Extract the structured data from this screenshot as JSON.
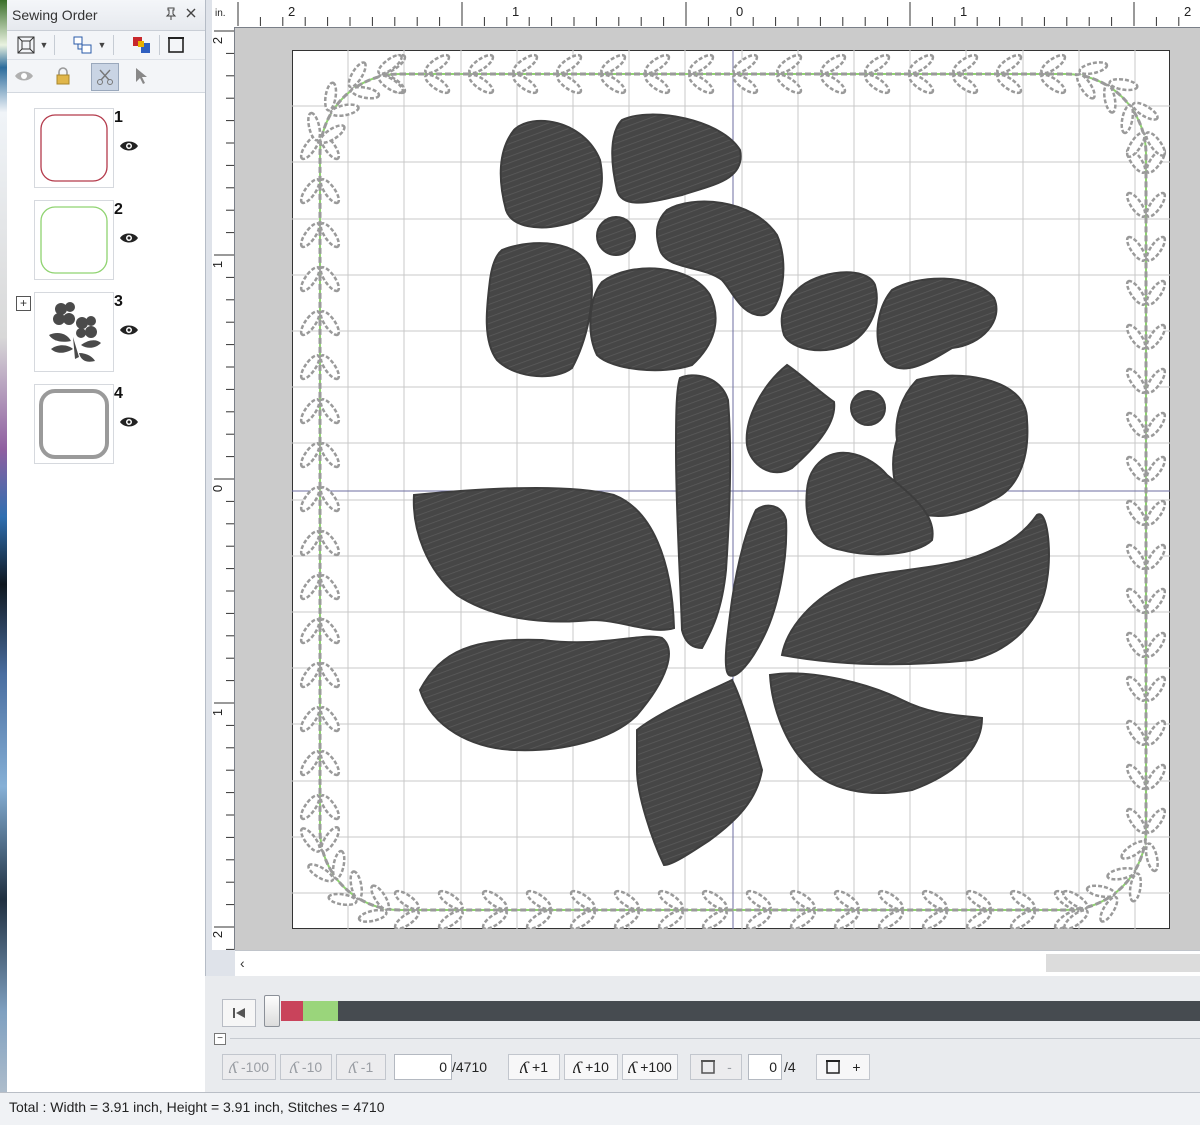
{
  "panel": {
    "title": "Sewing Order",
    "pin_icon": "pin-icon",
    "close_icon": "close-icon"
  },
  "sewing_order": [
    {
      "number": "1",
      "thumbnail": "square-outline-red"
    },
    {
      "number": "2",
      "thumbnail": "square-outline-green"
    },
    {
      "number": "3",
      "thumbnail": "flower-motif"
    },
    {
      "number": "4",
      "thumbnail": "square-outline-gray"
    }
  ],
  "ruler": {
    "unit": "in.",
    "top_labels": [
      "2",
      "1",
      "0",
      "1",
      "2"
    ],
    "left_labels": [
      "2",
      "1",
      "0",
      "1",
      "2"
    ]
  },
  "colors": {
    "frame_red": "#b43a4b",
    "frame_green": "#8fd370",
    "frame_gray": "#9a9a9a",
    "fill_dark": "#464646"
  },
  "simulator": {
    "buttons": {
      "minus100": "-100",
      "minus10": "-10",
      "minus1": "-1",
      "plus1": "+1",
      "plus10": "+10",
      "plus100": "+100"
    },
    "stitch_current": "0",
    "stitch_total": "/4710",
    "frame_minus": "-",
    "frame_plus": "+",
    "color_current": "0",
    "color_total": "/4"
  },
  "status": {
    "text": "Total : Width = 3.91 inch, Height = 3.91 inch, Stitches = 4710"
  }
}
